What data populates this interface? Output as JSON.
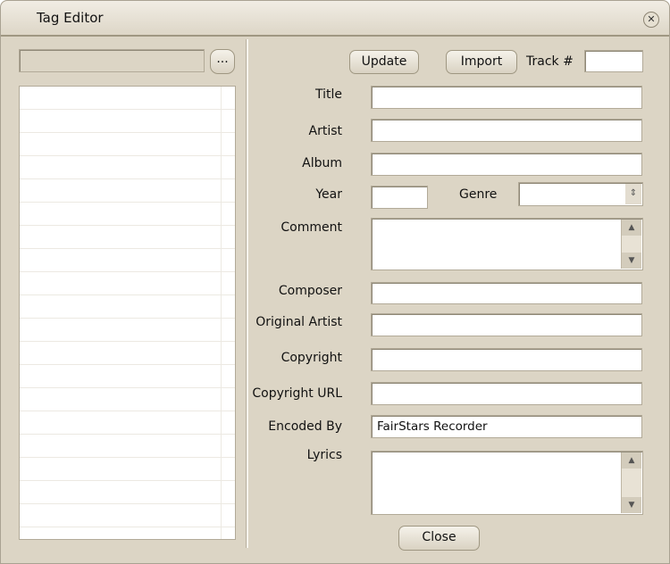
{
  "window": {
    "title": "Tag Editor",
    "close_icon": "close-icon"
  },
  "left": {
    "path_value": "",
    "browse_label": "..."
  },
  "toolbar": {
    "update": "Update",
    "import": "Import",
    "track_label": "Track #",
    "track_value": ""
  },
  "fields": {
    "title": {
      "label": "Title",
      "value": ""
    },
    "artist": {
      "label": "Artist",
      "value": ""
    },
    "album": {
      "label": "Album",
      "value": ""
    },
    "year": {
      "label": "Year",
      "value": ""
    },
    "genre": {
      "label": "Genre",
      "value": ""
    },
    "comment": {
      "label": "Comment",
      "value": ""
    },
    "composer": {
      "label": "Composer",
      "value": ""
    },
    "original_artist": {
      "label": "Original Artist",
      "value": ""
    },
    "copyright": {
      "label": "Copyright",
      "value": ""
    },
    "copyright_url": {
      "label": "Copyright URL",
      "value": ""
    },
    "encoded_by": {
      "label": "Encoded By",
      "value": "FairStars Recorder"
    },
    "lyrics": {
      "label": "Lyrics",
      "value": ""
    }
  },
  "footer": {
    "close": "Close"
  }
}
